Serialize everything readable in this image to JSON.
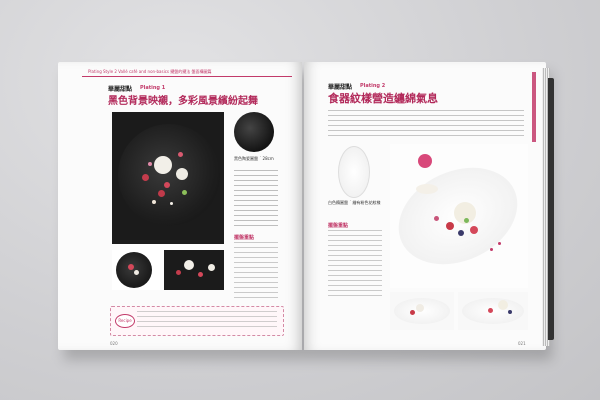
{
  "left_page": {
    "header": "Plating Style 2 Vallé café and non-basics 擺盤的擺法 盤面構圖篇",
    "section_label": "華麗甜點",
    "plate_number": "Plating 1",
    "title": "黑色背景映襯，多彩風景繽紛起舞",
    "small_plate_caption": "黑色陶瓷圓盤 ˙ 28cm",
    "tips_label": "擺盤重點",
    "note_badge": "Recipe",
    "page_number": "020"
  },
  "right_page": {
    "section_label": "華麗甜點",
    "plate_number": "Plating 2",
    "title": "食器紋樣營造纏綿氣息",
    "oval_plate_caption": "白色橢圓盤 ˙ 繪有粉色花紋樣",
    "tips_label": "擺盤重點",
    "page_number": "021"
  },
  "colors": {
    "accent": "#b2295a",
    "background": "#cfcfd2"
  }
}
